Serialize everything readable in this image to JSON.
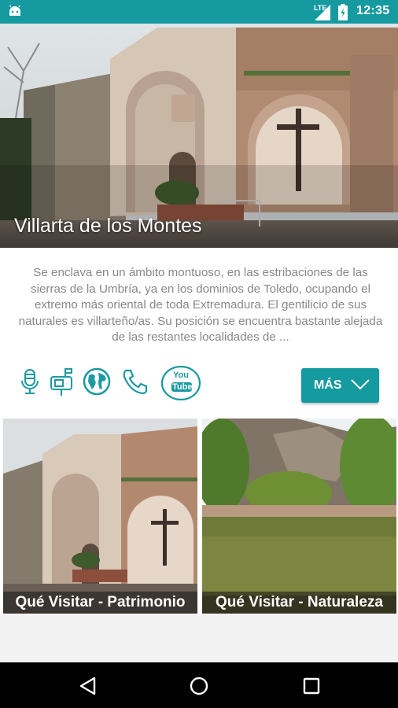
{
  "status_bar": {
    "network": "LTE",
    "time": "12:35"
  },
  "hero": {
    "title": "Villarta de los Montes"
  },
  "description": {
    "text": "Se enclava en un ámbito montuoso, en las estribaciones de las sierras de la Umbría, ya en los dominios de Toledo, ocupando el extremo más oriental de toda Extremadura. El gentilicio de sus naturales es villarteño/as. Su posición se encuentra bastante alejada de las restantes localidades de ..."
  },
  "actions": {
    "icons": [
      "microphone-icon",
      "mailbox-icon",
      "globe-icon",
      "phone-icon",
      "youtube-icon"
    ],
    "youtube_logo": {
      "top": "You",
      "bottom": "Tube"
    },
    "more_label": "MÁS"
  },
  "tiles": [
    {
      "label": "Qué Visitar - Patrimonio"
    },
    {
      "label": "Qué Visitar - Naturaleza"
    }
  ],
  "colors": {
    "accent": "#159aa0",
    "nav_bar": "#000000",
    "icon": "#1b9aa0"
  }
}
